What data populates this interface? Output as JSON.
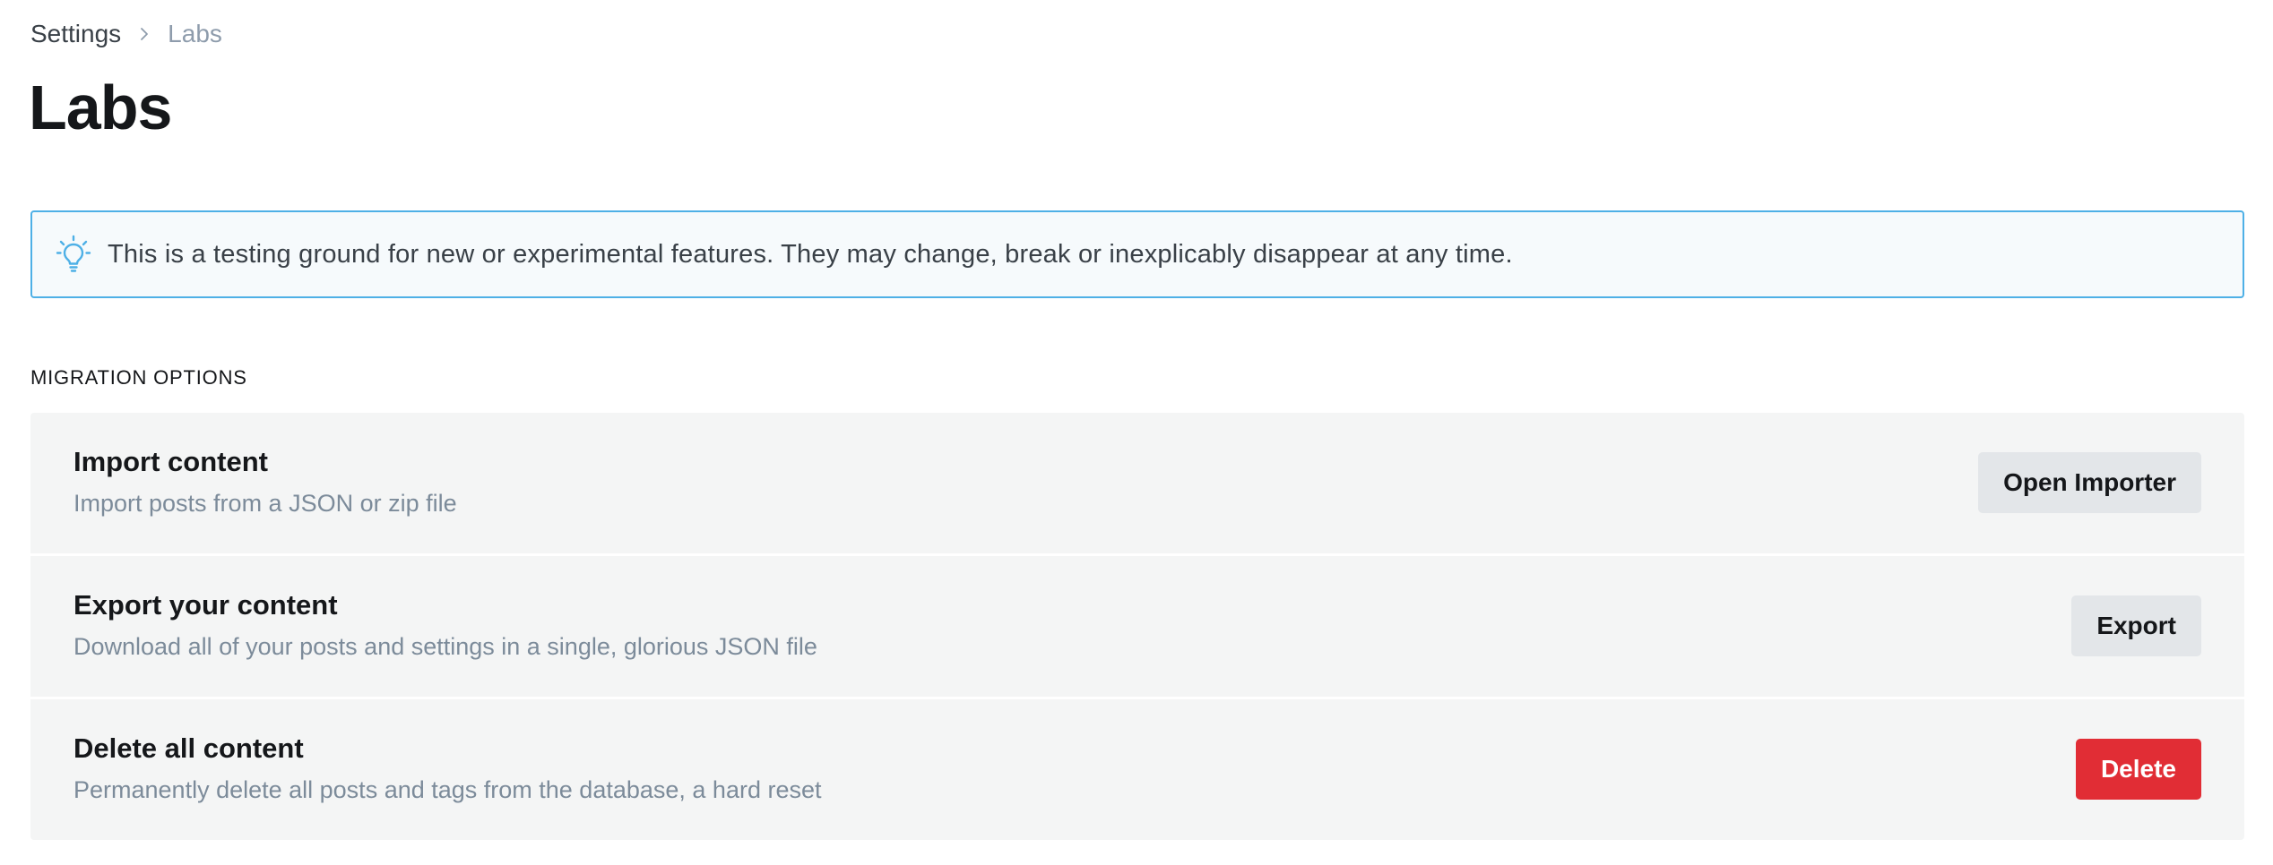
{
  "breadcrumb": {
    "root": "Settings",
    "separator_icon": "chevron-right-icon",
    "current": "Labs"
  },
  "page": {
    "title": "Labs"
  },
  "banner": {
    "icon": "lightbulb-icon",
    "text": "This is a testing ground for new or experimental features. They may change, break or inexplicably disappear at any time."
  },
  "migration": {
    "section_label": "MIGRATION OPTIONS",
    "items": [
      {
        "title": "Import content",
        "description": "Import posts from a JSON or zip file",
        "button_label": "Open Importer"
      },
      {
        "title": "Export your content",
        "description": "Download all of your posts and settings in a single, glorious JSON file",
        "button_label": "Export"
      },
      {
        "title": "Delete all content",
        "description": "Permanently delete all posts and tags from the database, a hard reset",
        "button_label": "Delete"
      }
    ]
  },
  "colors": {
    "banner_border": "#4eb0e6",
    "banner_background": "#f6fafc",
    "row_background": "#f4f5f5",
    "secondary_button": "#e3e6e9",
    "danger_button": "#e12d35",
    "muted_text": "#7c8b9a"
  }
}
